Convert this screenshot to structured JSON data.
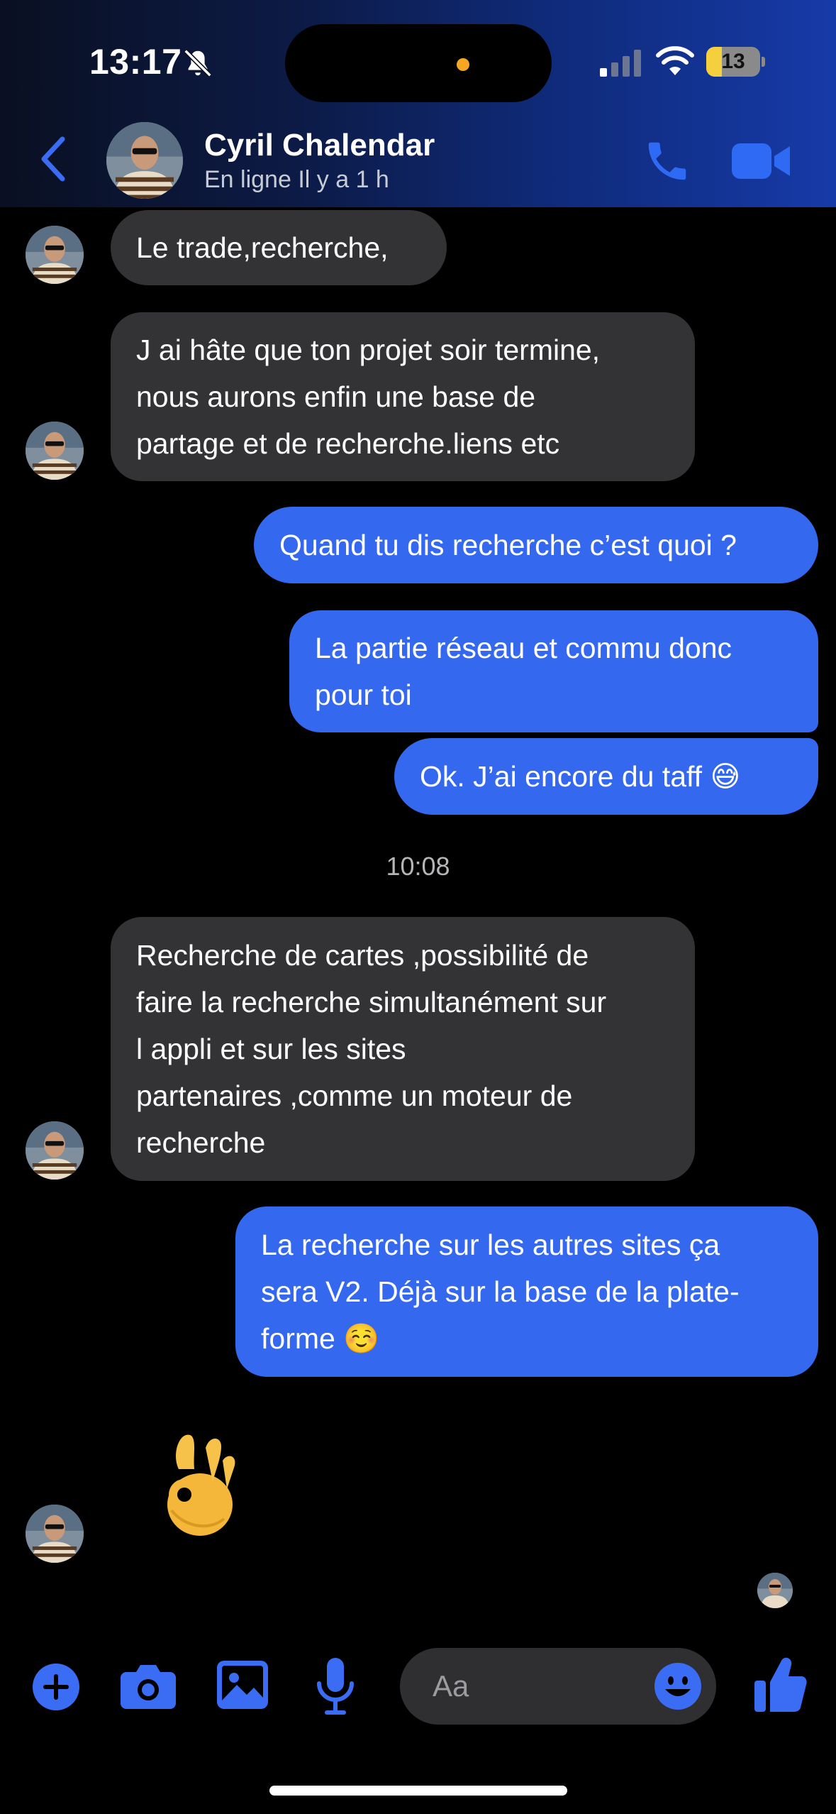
{
  "status_bar": {
    "time": "13:17",
    "battery": "13",
    "battery_level_percent": 13
  },
  "header": {
    "contact_name": "Cyril Chalendar",
    "contact_status": "En ligne Il y a 1 h",
    "accent": "#2f6af5"
  },
  "messages": [
    {
      "from": "contact",
      "text": "Le trade,recherche,"
    },
    {
      "from": "contact",
      "text": "J ai hâte que ton projet soir termine,\nnous aurons enfin une  base de\npartage et de recherche.liens etc"
    },
    {
      "from": "me",
      "text": "Quand tu dis recherche c’est quoi ?"
    },
    {
      "from": "me",
      "text": "La partie réseau et commu donc\npour toi"
    },
    {
      "from": "me",
      "text": "Ok. J’ai encore du taff 😅"
    },
    {
      "from": "contact",
      "text": "Recherche de  cartes ,possibilité de\nfaire la recherche simultanément sur\nl appli et sur les sites\npartenaires ,comme un moteur de\nrecherche"
    },
    {
      "from": "me",
      "text": "La recherche sur les autres sites ça\nsera V2. Déjà sur la base de la plate-\nforme ☺️"
    }
  ],
  "timestamp": "10:08",
  "reaction_emoji": "ok-hand",
  "composer": {
    "placeholder": "Aa"
  },
  "colors": {
    "incoming_bubble": "#333335",
    "outgoing_bubble": "#3468ef",
    "icons": "#3a6cf4"
  }
}
